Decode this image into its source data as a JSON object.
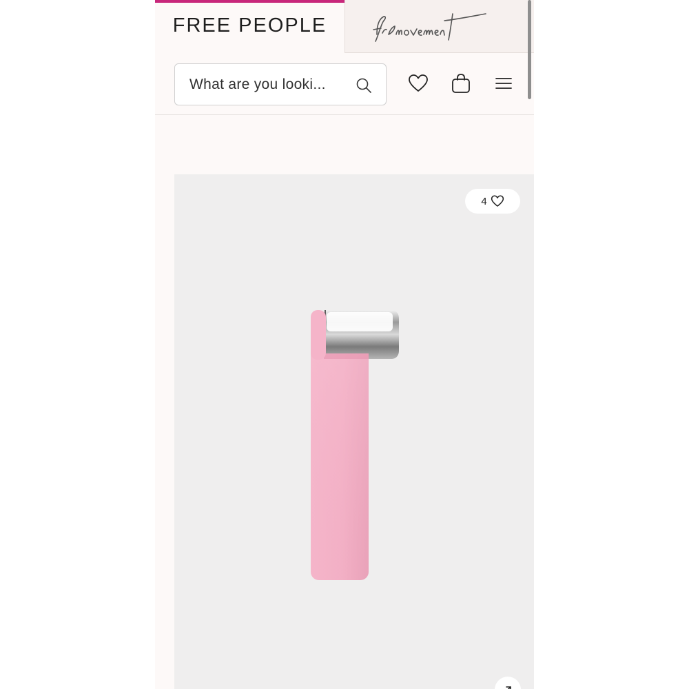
{
  "header": {
    "brand_tab_primary": "FREE PEOPLE",
    "brand_tab_secondary": "fp movement",
    "search": {
      "placeholder": "What are you looki..."
    },
    "icons": [
      "search-icon",
      "heart-icon",
      "bag-icon",
      "menu-icon"
    ]
  },
  "product": {
    "like_count": "4",
    "icons": [
      "heart-icon",
      "expand-arrow-icon"
    ]
  },
  "colors": {
    "accent": "#c8277b",
    "page_background": "#fdf9f8",
    "card_background": "#efeeee",
    "product_pink": "#f2b3c9"
  }
}
